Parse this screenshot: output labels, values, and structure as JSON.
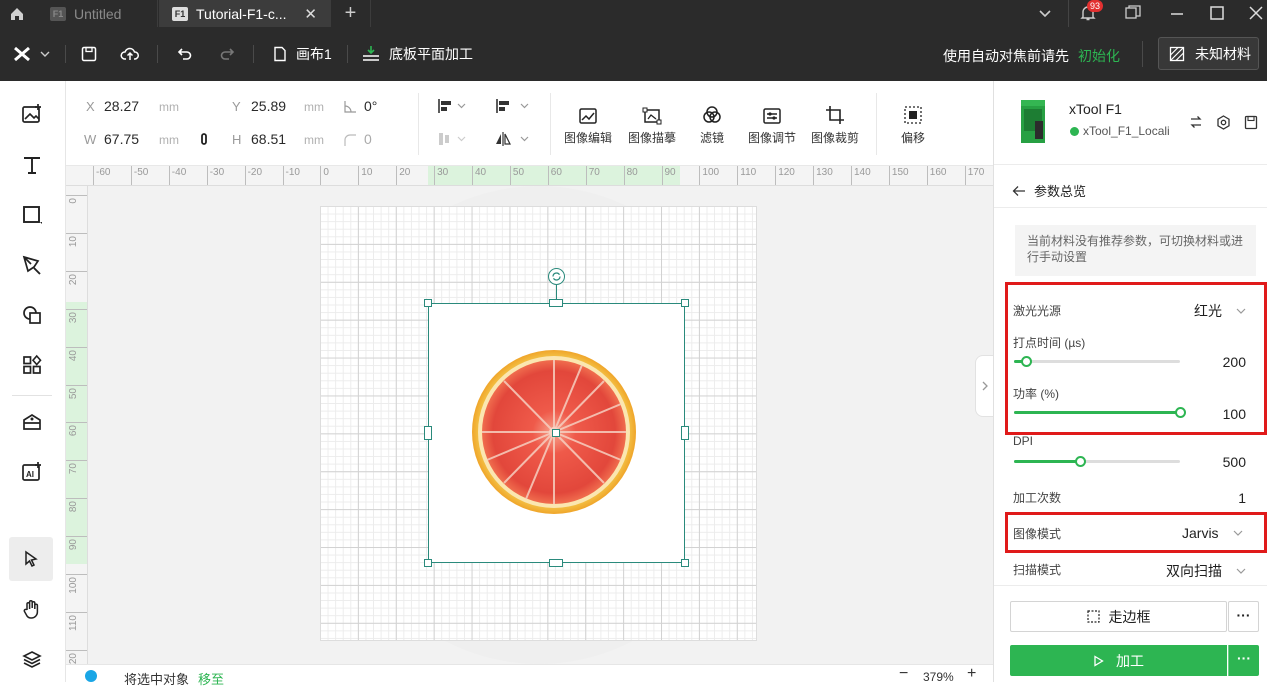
{
  "tabs": [
    {
      "icon_text": "F1",
      "label": "Untitled"
    },
    {
      "icon_text": "F1",
      "label": "Tutorial-F1-c..."
    }
  ],
  "notification_count": "93",
  "toolbar": {
    "canvas_label": "画布1",
    "mode_label": "底板平面加工",
    "autofocus_text": "使用自动对焦前请先",
    "init_link": "初始化",
    "material_button": "未知材料"
  },
  "props": {
    "x_label": "X",
    "x_value": "28.27",
    "x_unit": "mm",
    "y_label": "Y",
    "y_value": "25.89",
    "y_unit": "mm",
    "angle_value": "0°",
    "w_label": "W",
    "w_value": "67.75",
    "w_unit": "mm",
    "h_label": "H",
    "h_value": "68.51",
    "h_unit": "mm",
    "corner_value": "0"
  },
  "prop_buttons": [
    "图像编辑",
    "图像描摹",
    "滤镜",
    "图像调节",
    "图像裁剪",
    "偏移"
  ],
  "ruler": {
    "h_ticks": [
      "-60",
      "-50",
      "-40",
      "-30",
      "-20",
      "-10",
      "0",
      "10",
      "20",
      "30",
      "40",
      "50",
      "60",
      "70",
      "80",
      "90",
      "100",
      "110",
      "120",
      "130",
      "140",
      "150",
      "160",
      "170"
    ],
    "v_ticks": [
      "0",
      "10",
      "20",
      "30",
      "40",
      "50",
      "60",
      "70",
      "80",
      "90",
      "100",
      "110",
      "120"
    ]
  },
  "status": {
    "text": "将选中对象",
    "link": "移至",
    "zoom": "379%"
  },
  "device": {
    "name": "xTool F1",
    "connection": "xTool_F1_Locali"
  },
  "panel": {
    "back_title": "参数总览",
    "hint": "当前材料没有推荐参数，可切换材料或进行手动设置",
    "laser_label": "激光光源",
    "laser_value": "红光",
    "dot_time_label": "打点时间 (µs)",
    "dot_time_value": "200",
    "power_label": "功率 (%)",
    "power_value": "100",
    "dpi_label": "DPI",
    "dpi_value": "500",
    "passes_label": "加工次数",
    "passes_value": "1",
    "image_mode_label": "图像模式",
    "image_mode_value": "Jarvis",
    "scan_mode_label": "扫描模式",
    "scan_mode_value": "双向扫描",
    "frame_button": "走边框",
    "process_button": "加工"
  },
  "sliders": {
    "dot_time_fraction": 0.07,
    "power_fraction": 1.0,
    "dpi_fraction": 0.4
  },
  "colors": {
    "accent_green": "#2db552",
    "highlight_red": "#e01a1a",
    "selection_teal": "#2a8a7c"
  }
}
